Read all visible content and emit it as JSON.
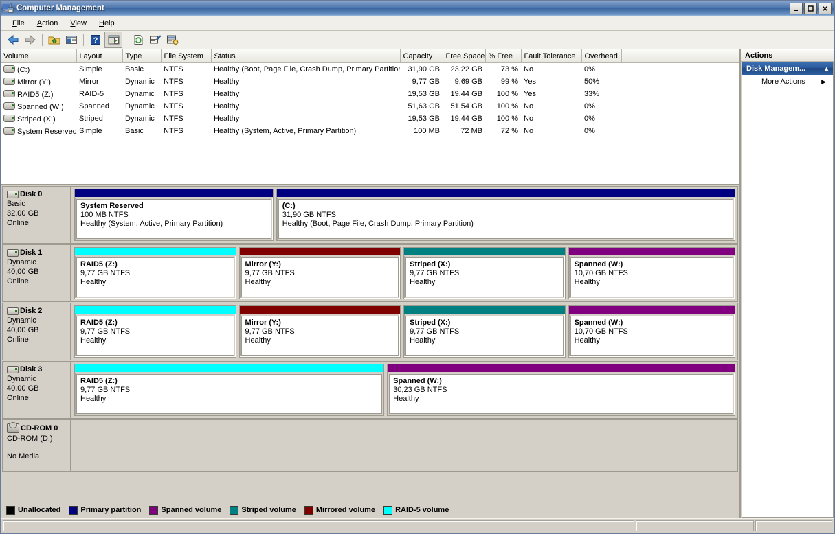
{
  "window": {
    "title": "Computer Management",
    "icon": "computer-management-icon",
    "buttons": {
      "minimize": "_",
      "maximize": "□",
      "close": "✕"
    }
  },
  "menu": [
    {
      "label": "File",
      "accel": "F"
    },
    {
      "label": "Action",
      "accel": "A"
    },
    {
      "label": "View",
      "accel": "V"
    },
    {
      "label": "Help",
      "accel": "H"
    }
  ],
  "toolbar": [
    {
      "name": "back-icon"
    },
    {
      "name": "forward-icon"
    },
    {
      "name": "up-folder-icon"
    },
    {
      "name": "show-tree-icon"
    },
    {
      "name": "help-icon"
    },
    {
      "name": "show-action-pane-icon"
    },
    {
      "name": "refresh-icon"
    },
    {
      "name": "properties-icon"
    },
    {
      "name": "rescan-disks-icon"
    }
  ],
  "volume_list": {
    "columns": [
      "Volume",
      "Layout",
      "Type",
      "File System",
      "Status",
      "Capacity",
      "Free Space",
      "% Free",
      "Fault Tolerance",
      "Overhead"
    ],
    "rows": [
      {
        "volume": "(C:)",
        "layout": "Simple",
        "type": "Basic",
        "fs": "NTFS",
        "status": "Healthy (Boot, Page File, Crash Dump, Primary Partition)",
        "capacity": "31,90 GB",
        "free": "23,22 GB",
        "pct_free": "73 %",
        "fault_tolerance": "No",
        "overhead": "0%"
      },
      {
        "volume": "Mirror (Y:)",
        "layout": "Mirror",
        "type": "Dynamic",
        "fs": "NTFS",
        "status": "Healthy",
        "capacity": "9,77 GB",
        "free": "9,69 GB",
        "pct_free": "99 %",
        "fault_tolerance": "Yes",
        "overhead": "50%"
      },
      {
        "volume": "RAID5 (Z:)",
        "layout": "RAID-5",
        "type": "Dynamic",
        "fs": "NTFS",
        "status": "Healthy",
        "capacity": "19,53 GB",
        "free": "19,44 GB",
        "pct_free": "100 %",
        "fault_tolerance": "Yes",
        "overhead": "33%"
      },
      {
        "volume": "Spanned (W:)",
        "layout": "Spanned",
        "type": "Dynamic",
        "fs": "NTFS",
        "status": "Healthy",
        "capacity": "51,63 GB",
        "free": "51,54 GB",
        "pct_free": "100 %",
        "fault_tolerance": "No",
        "overhead": "0%"
      },
      {
        "volume": "Striped (X:)",
        "layout": "Striped",
        "type": "Dynamic",
        "fs": "NTFS",
        "status": "Healthy",
        "capacity": "19,53 GB",
        "free": "19,44 GB",
        "pct_free": "100 %",
        "fault_tolerance": "No",
        "overhead": "0%"
      },
      {
        "volume": "System Reserved",
        "layout": "Simple",
        "type": "Basic",
        "fs": "NTFS",
        "status": "Healthy (System, Active, Primary Partition)",
        "capacity": "100 MB",
        "free": "72 MB",
        "pct_free": "72 %",
        "fault_tolerance": "No",
        "overhead": "0%"
      }
    ]
  },
  "disks": [
    {
      "name": "Disk 0",
      "kind": "Basic",
      "size": "32,00 GB",
      "state": "Online",
      "icon": "disk-icon",
      "volumes": [
        {
          "name": "System Reserved",
          "size_fs": "100 MB NTFS",
          "status": "Healthy (System, Active, Primary Partition)",
          "color": "#000080",
          "flex": 285
        },
        {
          "name": "(C:)",
          "size_fs": "31,90 GB NTFS",
          "status": "Healthy (Boot, Page File, Crash Dump, Primary Partition)",
          "color": "#000080",
          "flex": 660
        }
      ]
    },
    {
      "name": "Disk 1",
      "kind": "Dynamic",
      "size": "40,00 GB",
      "state": "Online",
      "icon": "disk-icon",
      "volumes": [
        {
          "name": "RAID5 (Z:)",
          "size_fs": "9,77 GB NTFS",
          "status": "Healthy",
          "color": "#00ffff",
          "flex": 238
        },
        {
          "name": "Mirror (Y:)",
          "size_fs": "9,77 GB NTFS",
          "status": "Healthy",
          "color": "#800000",
          "flex": 238
        },
        {
          "name": "Striped (X:)",
          "size_fs": "9,77 GB NTFS",
          "status": "Healthy",
          "color": "#008080",
          "flex": 238
        },
        {
          "name": "Spanned (W:)",
          "size_fs": "10,70 GB NTFS",
          "status": "Healthy",
          "color": "#800080",
          "flex": 246
        }
      ]
    },
    {
      "name": "Disk 2",
      "kind": "Dynamic",
      "size": "40,00 GB",
      "state": "Online",
      "icon": "disk-icon",
      "volumes": [
        {
          "name": "RAID5 (Z:)",
          "size_fs": "9,77 GB NTFS",
          "status": "Healthy",
          "color": "#00ffff",
          "flex": 238
        },
        {
          "name": "Mirror (Y:)",
          "size_fs": "9,77 GB NTFS",
          "status": "Healthy",
          "color": "#800000",
          "flex": 238
        },
        {
          "name": "Striped (X:)",
          "size_fs": "9,77 GB NTFS",
          "status": "Healthy",
          "color": "#008080",
          "flex": 238
        },
        {
          "name": "Spanned (W:)",
          "size_fs": "10,70 GB NTFS",
          "status": "Healthy",
          "color": "#800080",
          "flex": 246
        }
      ]
    },
    {
      "name": "Disk 3",
      "kind": "Dynamic",
      "size": "40,00 GB",
      "state": "Online",
      "icon": "disk-icon",
      "volumes": [
        {
          "name": "RAID5 (Z:)",
          "size_fs": "9,77 GB NTFS",
          "status": "Healthy",
          "color": "#00ffff",
          "flex": 452
        },
        {
          "name": "Spanned (W:)",
          "size_fs": "30,23 GB NTFS",
          "status": "Healthy",
          "color": "#800080",
          "flex": 508
        }
      ]
    }
  ],
  "cdrom": {
    "name": "CD-ROM 0",
    "icon": "cdrom-icon",
    "drive": "CD-ROM (D:)",
    "state": "No Media"
  },
  "legend": [
    {
      "label": "Unallocated",
      "color": "#000000"
    },
    {
      "label": "Primary partition",
      "color": "#000080"
    },
    {
      "label": "Spanned volume",
      "color": "#800080"
    },
    {
      "label": "Striped volume",
      "color": "#008080"
    },
    {
      "label": "Mirrored volume",
      "color": "#800000"
    },
    {
      "label": "RAID-5 volume",
      "color": "#00ffff"
    }
  ],
  "actions": {
    "header": "Actions",
    "group": "Disk Managem...",
    "group_collapse_icon": "chevron-up-icon",
    "items": [
      {
        "label": "More Actions",
        "submenu_icon": "chevron-right-icon"
      }
    ]
  },
  "statusbar": {
    "left": "",
    "middle": "",
    "right": ""
  }
}
